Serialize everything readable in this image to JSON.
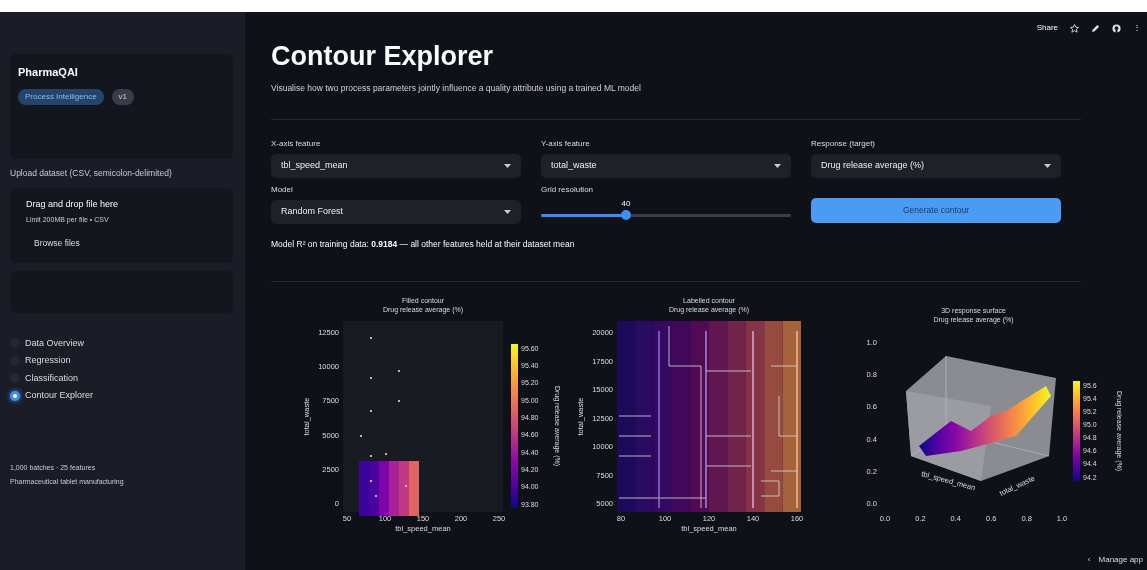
{
  "top_bar": {
    "share": "Share",
    "more": "⋮"
  },
  "sidebar": {
    "app_name": "PharmaQAI",
    "badges": [
      {
        "text": "Process Intelligence",
        "kind": "primary"
      },
      {
        "text": "v1",
        "kind": "secondary"
      }
    ],
    "upload": {
      "label": "Upload dataset (CSV, semicolon-delimited)",
      "dropzone_title": "Drag and drop file here",
      "dropzone_hint": "Limit 200MB per file • CSV",
      "button": "Browse files"
    },
    "nav": [
      {
        "label": "Data Overview",
        "selected": false
      },
      {
        "label": "Regression",
        "selected": false
      },
      {
        "label": "Classification",
        "selected": false
      },
      {
        "label": "Contour Explorer",
        "selected": true
      }
    ],
    "footer": [
      "1,000 batches · 25 features",
      "Pharmaceutical tablet manufacturing"
    ]
  },
  "main": {
    "title": "Contour Explorer",
    "subtitle": "Visualise how two process parameters jointly influence a quality attribute using a trained ML model",
    "controls": [
      {
        "kind": "select",
        "label": "X-axis feature",
        "value": "tbl_speed_mean"
      },
      {
        "kind": "select",
        "label": "Y-axis feature",
        "value": "total_waste"
      },
      {
        "kind": "select",
        "label": "Response (target)",
        "value": "Drug release average (%)"
      },
      {
        "kind": "select",
        "label": "Model",
        "value": "Random Forest"
      },
      {
        "kind": "slider",
        "label": "Grid resolution",
        "value": "40",
        "level": 0.34
      },
      {
        "kind": "button",
        "label": "Generate contour"
      }
    ],
    "note": "Model R² on training data: **0.9184** — all other features held at their dataset mean",
    "plots": [
      {
        "kind": "filled",
        "title": [
          "Filled contour",
          "Drug release average (%)"
        ],
        "xticks": [
          "50",
          "100",
          "150",
          "200",
          "250"
        ],
        "yticks": [
          "12500",
          "10000",
          "7500",
          "5000",
          "2500",
          "0"
        ],
        "xlabel": "tbl_speed_mean",
        "ylabel": "total_waste",
        "colorbar": {
          "label": "Drug release average (%)",
          "ticks": [
            "95.60",
            "95.40",
            "95.20",
            "95.00",
            "94.80",
            "94.60",
            "94.40",
            "94.20",
            "94.00",
            "93.80"
          ]
        }
      },
      {
        "kind": "labeled",
        "title": [
          "Labelled contour",
          "Drug release average (%)"
        ],
        "xticks": [
          "80",
          "100",
          "120",
          "140",
          "160"
        ],
        "yticks": [
          "20000",
          "17500",
          "15000",
          "12500",
          "10000",
          "7500",
          "5000"
        ],
        "xlabel": "tbl_speed_mean",
        "ylabel": "total_waste"
      },
      {
        "kind": "surface",
        "title": [
          "3D response surface",
          "Drug release average (%)"
        ],
        "xticks": [
          "0.0",
          "0.2",
          "0.4",
          "0.6",
          "0.8",
          "1.0"
        ],
        "yticks": [
          "1.0",
          "0.8",
          "0.6",
          "0.4",
          "0.2",
          "0.0"
        ],
        "xlabel": "tbl_speed_mean",
        "ylabel": "total_waste",
        "colorbar": {
          "label": "Drug release average (%)",
          "ticks": [
            "95.6",
            "95.4",
            "95.2",
            "95.0",
            "94.8",
            "94.6",
            "94.4",
            "94.2"
          ]
        }
      }
    ]
  },
  "manage_app": {
    "icon": "‹",
    "label": "Manage app"
  }
}
